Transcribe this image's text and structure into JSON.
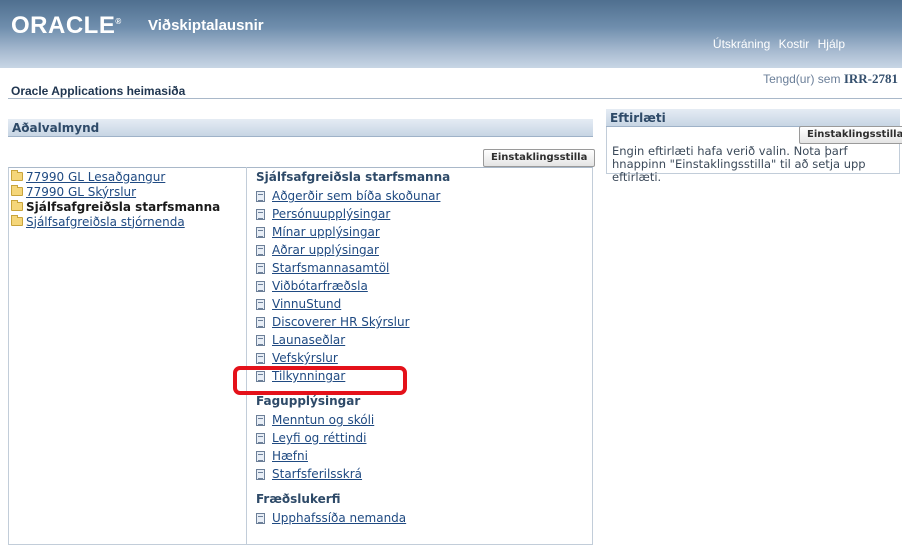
{
  "header": {
    "logo": "ORACLE",
    "app_name": "Viðskiptalausnir",
    "links": [
      "Útskráning",
      "Kostir",
      "Hjálp"
    ]
  },
  "logged_in": {
    "prefix": "Tengd(ur) sem",
    "user": "IRR-2781"
  },
  "page_title": "Oracle Applications heimasiða",
  "main_menu": {
    "title": "Aðalvalmynd",
    "personalize_button": "Einstaklingsstilla",
    "responsibilities": [
      {
        "label": "77990 GL Lesaðgangur",
        "selected": false
      },
      {
        "label": "77990 GL Skýrslur",
        "selected": false
      },
      {
        "label": "Sjálfsafgreiðsla starfsmanna",
        "selected": true
      },
      {
        "label": "Sjálfsafgreiðsla stjórnenda",
        "selected": false
      }
    ],
    "groups": [
      {
        "title": "Sjálfsafgreiðsla starfsmanna",
        "items": [
          "Aðgerðir sem bíða skoðunar",
          "Persónuupplýsingar",
          "Mínar upplýsingar",
          "Aðrar upplýsingar",
          "Starfsmannasamtöl",
          "Viðbótarfræðsla",
          "VinnuStund",
          "Discoverer HR Skýrslur",
          "Launaseðlar",
          "Vefskýrslur",
          "Tilkynningar"
        ]
      },
      {
        "title": "Fagupplýsingar",
        "items": [
          "Menntun og skóli",
          "Leyfi og réttindi",
          "Hæfni",
          "Starfsferilsskrá"
        ]
      },
      {
        "title": "Fræðslukerfi",
        "items": [
          "Upphafssíða nemanda"
        ]
      }
    ]
  },
  "favorites": {
    "title": "Eftirlæti",
    "personalize_button": "Einstaklingsstilla",
    "text": "Engin eftirlæti hafa verið valin. Nota þarf hnappinn \"Einstaklingsstilla\" til að setja upp eftirlæti."
  },
  "colors": {
    "highlight": "#e4111a",
    "link": "#1f4a82",
    "header": "#6f8ead"
  }
}
